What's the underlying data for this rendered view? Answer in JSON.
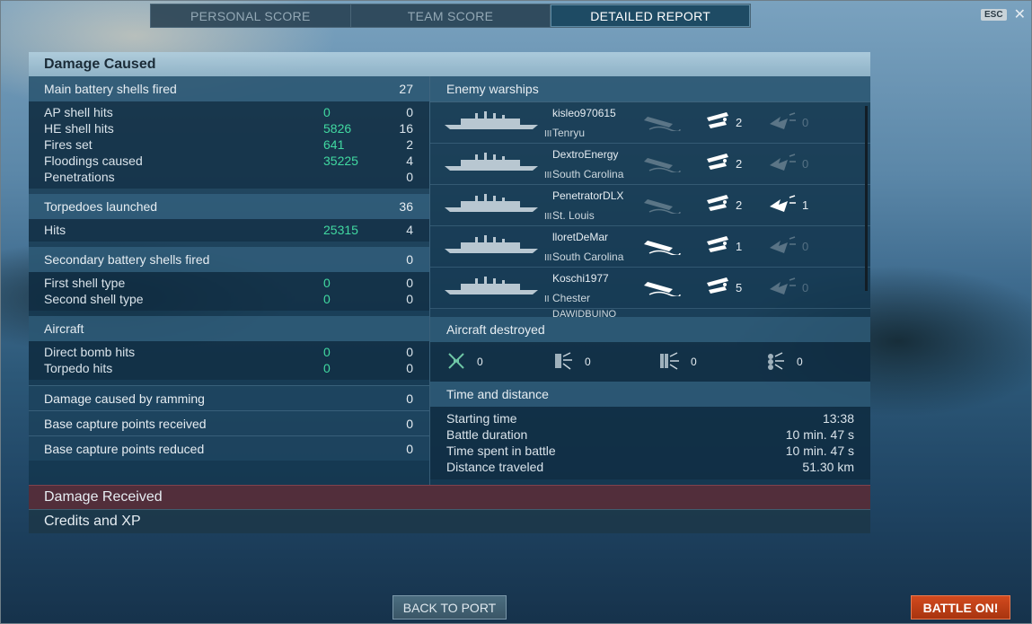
{
  "tabs": [
    {
      "label": "PERSONAL SCORE"
    },
    {
      "label": "TEAM SCORE"
    },
    {
      "label": "DETAILED REPORT"
    }
  ],
  "esc_label": "ESC",
  "close_glyph": "✕",
  "damage_caused": {
    "title": "Damage Caused",
    "main_battery": {
      "label": "Main battery shells fired",
      "value": "27",
      "rows": [
        {
          "label": "AP shell hits",
          "damage": "0",
          "count": "0"
        },
        {
          "label": "HE shell hits",
          "damage": "5826",
          "count": "16"
        },
        {
          "label": "Fires set",
          "damage": "641",
          "count": "2"
        },
        {
          "label": "Floodings caused",
          "damage": "35225",
          "count": "4"
        },
        {
          "label": "Penetrations",
          "damage": "",
          "count": "0"
        }
      ]
    },
    "torpedoes": {
      "label": "Torpedoes launched",
      "value": "36",
      "rows": [
        {
          "label": "Hits",
          "damage": "25315",
          "count": "4"
        }
      ]
    },
    "secondary": {
      "label": "Secondary battery shells fired",
      "value": "0",
      "rows": [
        {
          "label": "First shell type",
          "damage": "0",
          "count": "0"
        },
        {
          "label": "Second shell type",
          "damage": "0",
          "count": "0"
        }
      ]
    },
    "aircraft": {
      "label": "Aircraft",
      "rows": [
        {
          "label": "Direct bomb hits",
          "damage": "0",
          "count": "0"
        },
        {
          "label": "Torpedo hits",
          "damage": "0",
          "count": "0"
        }
      ]
    },
    "ramming": {
      "label": "Damage caused by ramming",
      "value": "0"
    },
    "capture_received": {
      "label": "Base capture points received",
      "value": "0"
    },
    "capture_reduced": {
      "label": "Base capture points reduced",
      "value": "0"
    }
  },
  "enemy_warships": {
    "title": "Enemy warships",
    "ships": [
      {
        "player": "kisleo970615",
        "ship": "Tenryu",
        "tier": "III",
        "destroyed": false,
        "hits": "2",
        "crits": "0"
      },
      {
        "player": "DextroEnergy",
        "ship": "South Carolina",
        "tier": "III",
        "destroyed": false,
        "hits": "2",
        "crits": "0"
      },
      {
        "player": "PenetratorDLX",
        "ship": "St. Louis",
        "tier": "III",
        "destroyed": false,
        "hits": "2",
        "crits": "1"
      },
      {
        "player": "lloretDeMar",
        "ship": "South Carolina",
        "tier": "III",
        "destroyed": true,
        "hits": "1",
        "crits": "0"
      },
      {
        "player": "Koschi1977",
        "ship": "Chester",
        "tier": "II",
        "destroyed": true,
        "hits": "5",
        "crits": "0"
      }
    ],
    "partial_player": "DAWIDBUINO"
  },
  "aircraft_destroyed": {
    "title": "Aircraft destroyed",
    "items": [
      {
        "icon": "fighter-icon",
        "value": "0"
      },
      {
        "icon": "torpedo-bomber-icon",
        "value": "0"
      },
      {
        "icon": "dive-bomber-icon",
        "value": "0"
      },
      {
        "icon": "bomber-group-icon",
        "value": "0"
      }
    ]
  },
  "time_distance": {
    "title": "Time and distance",
    "rows": [
      {
        "label": "Starting time",
        "value": "13:38"
      },
      {
        "label": "Battle duration",
        "value": "10 min. 47 s"
      },
      {
        "label": "Time spent in battle",
        "value": "10 min. 47 s"
      },
      {
        "label": "Distance traveled",
        "value": "51.30 km"
      }
    ]
  },
  "damage_received_title": "Damage Received",
  "credits_xp_title": "Credits and XP",
  "back_to_port": "BACK TO PORT",
  "battle_on": "BATTLE ON!",
  "colors": {
    "accent_green": "#41d9a1",
    "battle_button": "#c2421a"
  }
}
